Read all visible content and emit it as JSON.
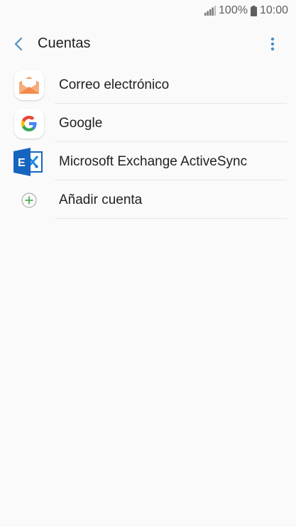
{
  "status_bar": {
    "battery_text": "100%",
    "time": "10:00",
    "icons": [
      "signal-icon",
      "battery-icon"
    ]
  },
  "header": {
    "title": "Cuentas",
    "back_icon": "chevron-left-icon",
    "menu_icon": "more-vertical-icon"
  },
  "accounts": [
    {
      "label": "Correo electrónico",
      "icon": "email-icon"
    },
    {
      "label": "Google",
      "icon": "google-icon"
    },
    {
      "label": "Microsoft Exchange ActiveSync",
      "icon": "exchange-icon"
    },
    {
      "label": "Añadir cuenta",
      "icon": "add-icon"
    }
  ],
  "colors": {
    "accent": "#4a90c8",
    "background": "#fafafa",
    "email_orange": "#f4a06a",
    "exchange_blue": "#1565c0",
    "add_green": "#4caf50"
  }
}
